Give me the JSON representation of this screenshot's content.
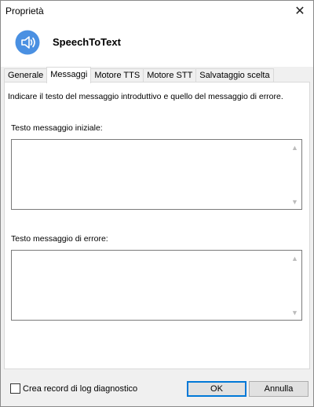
{
  "window": {
    "title": "Proprietà",
    "close_glyph": "✕"
  },
  "header": {
    "app_icon": "speaker-icon",
    "app_name": "SpeechToText"
  },
  "tabs": [
    {
      "label": "Generale",
      "active": false
    },
    {
      "label": "Messaggi",
      "active": true
    },
    {
      "label": "Motore TTS",
      "active": false
    },
    {
      "label": "Motore STT",
      "active": false
    },
    {
      "label": "Salvataggio scelta",
      "active": false
    }
  ],
  "panel": {
    "description": "Indicare il testo del messaggio introduttivo e quello del messaggio di errore.",
    "initial_label": "Testo messaggio iniziale:",
    "initial_value": "",
    "error_label": "Testo messaggio di errore:",
    "error_value": ""
  },
  "footer": {
    "log_checkbox_label": "Crea record di log diagnostico",
    "log_checked": false,
    "ok_label": "OK",
    "cancel_label": "Annulla"
  },
  "colors": {
    "accent": "#0078d7",
    "icon_blue": "#4a90e2"
  }
}
